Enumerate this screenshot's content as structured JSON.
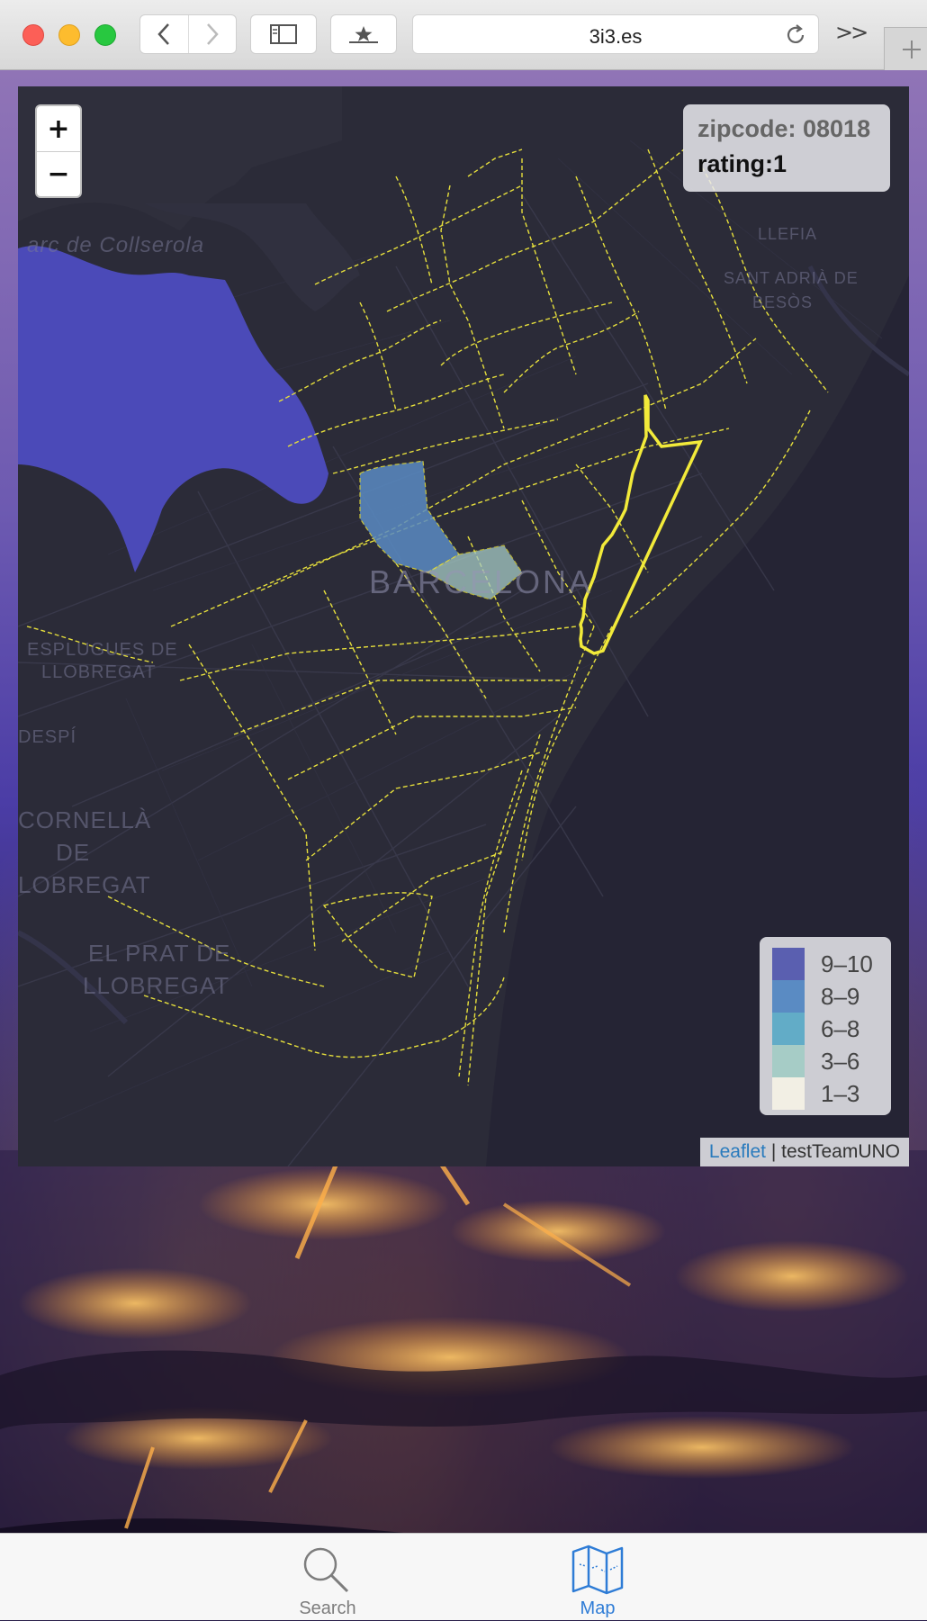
{
  "browser": {
    "url": "3i3.es",
    "overflow_label": ">>",
    "new_tab_label": "+"
  },
  "map": {
    "zoom_in": "+",
    "zoom_out": "−",
    "info": {
      "zipcode_text": "zipcode: 08018",
      "rating_text": "rating:1"
    },
    "legend": [
      {
        "label": "9–10",
        "color": "#5a5fb0"
      },
      {
        "label": "8–9",
        "color": "#5a8bc3"
      },
      {
        "label": "6–8",
        "color": "#62acc7"
      },
      {
        "label": "3–6",
        "color": "#a6ccc6"
      },
      {
        "label": "1–3",
        "color": "#f2efe4"
      }
    ],
    "attribution": {
      "link_text": "Leaflet",
      "separator": "|",
      "credit": "testTeamUNO"
    },
    "place_labels": {
      "collserola": "arc de Collserola",
      "llefia": "LLEFIA",
      "sant_adria": "SANT ADRIÀ DE",
      "besos": "BESÒS",
      "barcelona": "BARCELONA",
      "esplugues_1": "ESPLUGUES DE",
      "esplugues_2": "LLOBREGAT",
      "despi": "DESPÍ",
      "cornella_1": "CORNELLÀ",
      "cornella_2": "DE",
      "cornella_3": "LOBREGAT",
      "prat_1": "EL PRAT DE",
      "prat_2": "LLOBREGAT"
    },
    "colors": {
      "district_outline": "#e6df3c",
      "selected_outline": "#f2ea3a",
      "park_fill": "#4b4ab8"
    }
  },
  "tabbar": {
    "search_label": "Search",
    "map_label": "Map",
    "active_color": "#2e7cd6"
  }
}
